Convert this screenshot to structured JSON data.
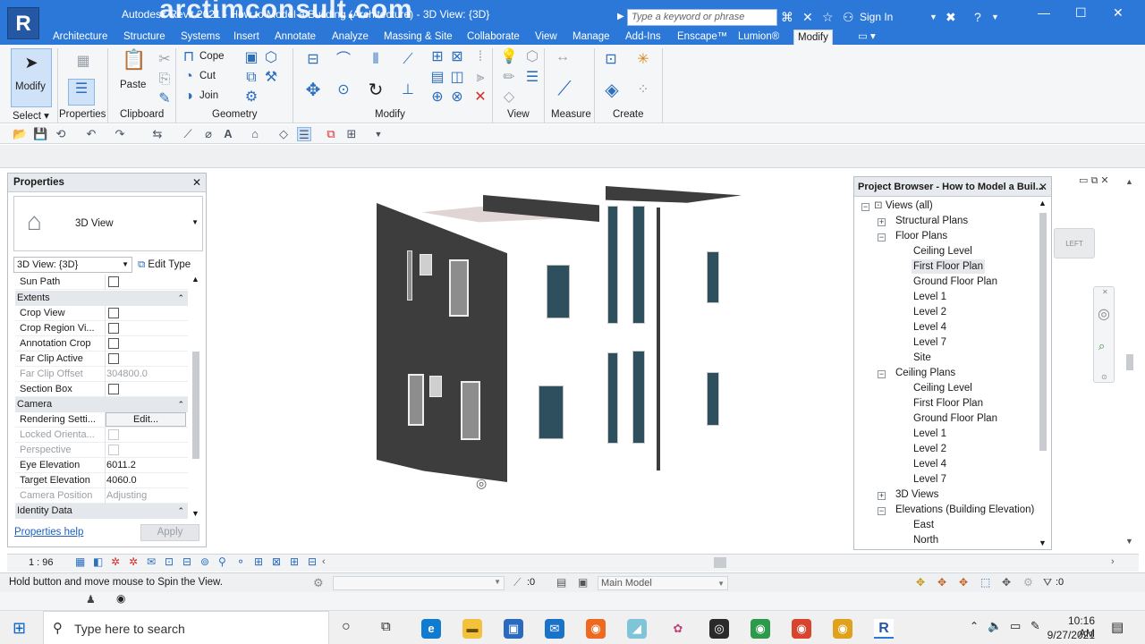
{
  "title_bar": {
    "app_title": "Autodesk Revit 2021 - How to Model a Building (Architecture) - 3D View: {3D}",
    "watermark": "arctimconsult.com",
    "search_placeholder": "Type a keyword or phrase",
    "signin": "Sign In",
    "logo": "R"
  },
  "tabs": [
    "Architecture",
    "Structure",
    "Systems",
    "Insert",
    "Annotate",
    "Analyze",
    "Massing & Site",
    "Collaborate",
    "View",
    "Manage",
    "Add-Ins",
    "Enscape™",
    "Lumion®",
    "Modify"
  ],
  "active_tab": "Modify",
  "ribbon": {
    "modify_label": "Modify",
    "paste_label": "Paste",
    "cope_label": "Cope",
    "cut_label": "Cut",
    "join_label": "Join",
    "panels": [
      "Select",
      "Properties",
      "Clipboard",
      "Geometry",
      "Modify",
      "View",
      "Measure",
      "Create"
    ]
  },
  "properties": {
    "title": "Properties",
    "type_name": "3D View",
    "view_selector": "3D View: {3D}",
    "edit_type": "Edit Type",
    "groups": {
      "extents": "Extents",
      "camera": "Camera",
      "identity": "Identity Data"
    },
    "rows": {
      "sun_path": "Sun Path",
      "crop_view": "Crop View",
      "crop_region_visible": "Crop Region Vi...",
      "annotation_crop": "Annotation Crop",
      "far_clip_active": "Far Clip Active",
      "far_clip_offset": "Far Clip Offset",
      "far_clip_offset_value": "304800.0",
      "section_box": "Section Box",
      "rendering_settings": "Rendering Setti...",
      "rendering_edit": "Edit...",
      "locked_orientation": "Locked Orienta...",
      "perspective": "Perspective",
      "eye_elevation": "Eye Elevation",
      "eye_elevation_value": "6011.2",
      "target_elevation": "Target Elevation",
      "target_elevation_value": "4060.0",
      "camera_position": "Camera Position",
      "camera_position_value": "Adjusting"
    },
    "help_link": "Properties help",
    "apply": "Apply"
  },
  "browser": {
    "title": "Project Browser - How to Model a Buil...",
    "items": {
      "views_all": "Views (all)",
      "structural_plans": "Structural Plans",
      "floor_plans": "Floor Plans",
      "fp_ceiling": "Ceiling Level",
      "fp_first": "First Floor Plan",
      "fp_ground": "Ground Floor Plan",
      "fp_l1": "Level 1",
      "fp_l2": "Level 2",
      "fp_l4": "Level 4",
      "fp_l7": "Level 7",
      "fp_site": "Site",
      "ceiling_plans": "Ceiling Plans",
      "cp_ceiling": "Ceiling Level",
      "cp_first": "First Floor Plan",
      "cp_ground": "Ground Floor Plan",
      "cp_l1": "Level 1",
      "cp_l2": "Level 2",
      "cp_l4": "Level 4",
      "cp_l7": "Level 7",
      "views_3d": "3D Views",
      "elevations": "Elevations (Building Elevation)",
      "el_east": "East",
      "el_north": "North"
    }
  },
  "viewbar": {
    "scale": "1 : 96"
  },
  "viewcube": {
    "face": "LEFT"
  },
  "statusbar": {
    "message": "Hold button and move mouse to Spin the View.",
    "worksets_count": ":0",
    "model": "Main Model",
    "filter_count": ":0"
  },
  "taskbar": {
    "search_placeholder": "Type here to search",
    "time": "10:16 AM",
    "date": "9/27/2021"
  },
  "colors": {
    "accent": "#2b78d8",
    "wall_dark": "#3d3d3d",
    "glass": "#2e4f5e"
  }
}
